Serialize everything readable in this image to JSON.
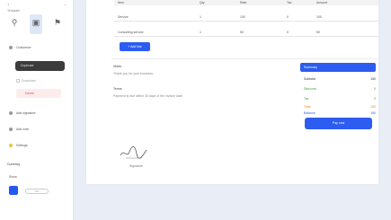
{
  "sidebar": {
    "page_number": "1",
    "subtitle": "Template",
    "template_icons": [
      "pin-icon",
      "image-icon",
      "flag-icon"
    ],
    "items": [
      {
        "label": "Customize"
      },
      {
        "label": "Duplicate"
      },
      {
        "label": "Download"
      },
      {
        "label": "Delete"
      },
      {
        "label": "Add signature"
      },
      {
        "label": "Add note"
      },
      {
        "label": "Settings"
      },
      {
        "label": "Currency"
      },
      {
        "label": "Show"
      },
      {
        "label": "Tax"
      }
    ]
  },
  "invoice": {
    "table_headers": [
      "Item",
      "Qty",
      "Rate",
      "Tax",
      "Amount"
    ],
    "rows": [
      {
        "item": "Service",
        "qty": "1",
        "rate": "100",
        "tax": "0",
        "amount": "100"
      },
      {
        "item": "Consulting service",
        "qty": "1",
        "rate": "50",
        "tax": "0",
        "amount": "50"
      }
    ],
    "add_line_label": "+ Add line",
    "notes_title": "Notes",
    "notes_text": "Thank you for your business.",
    "terms_title": "Terms",
    "terms_text": "Payment is due within 30 days of the invoice date.",
    "summary_title": "Summary",
    "summary": [
      {
        "label": "Subtotal",
        "value": "150",
        "color": "#333333"
      },
      {
        "label": "Discount",
        "value": "0",
        "color": "#3a9a3a"
      },
      {
        "label": "Tax",
        "value": "0",
        "color": "#3a9a3a"
      },
      {
        "label": "Total",
        "value": "150",
        "color": "#e08a00"
      },
      {
        "label": "Balance",
        "value": "150",
        "color": "#2d5cf0"
      }
    ],
    "pay_label": "Pay now",
    "signature_name": "Signature"
  },
  "colors": {
    "accent": "#2d5cf0",
    "danger": "#e06060"
  }
}
